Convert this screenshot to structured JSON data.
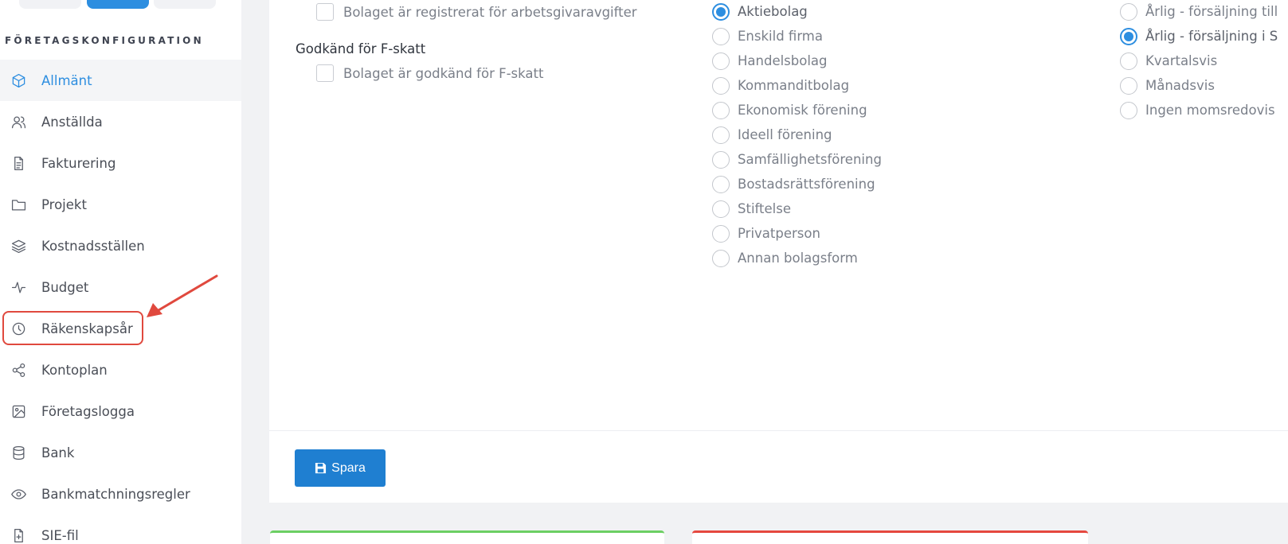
{
  "sidebar": {
    "section_title": "FÖRETAGSKONFIGURATION",
    "items": [
      {
        "label": "Allmänt",
        "icon": "cube-icon",
        "active": true
      },
      {
        "label": "Anställda",
        "icon": "users-icon"
      },
      {
        "label": "Fakturering",
        "icon": "document-icon"
      },
      {
        "label": "Projekt",
        "icon": "folder-icon"
      },
      {
        "label": "Kostnadsställen",
        "icon": "layers-icon"
      },
      {
        "label": "Budget",
        "icon": "activity-icon"
      },
      {
        "label": "Räkenskapsår",
        "icon": "clock-icon"
      },
      {
        "label": "Kontoplan",
        "icon": "share-icon"
      },
      {
        "label": "Företagslogga",
        "icon": "image-icon"
      },
      {
        "label": "Bank",
        "icon": "database-icon"
      },
      {
        "label": "Bankmatchningsregler",
        "icon": "eye-icon"
      },
      {
        "label": "SIE-fil",
        "icon": "file-plus-icon"
      }
    ]
  },
  "form": {
    "employer_fee_checkbox": "Bolaget är registrerat för arbetsgivaravgifter",
    "f_tax_heading": "Godkänd för F-skatt",
    "f_tax_checkbox": "Bolaget är godkänd för F-skatt",
    "company_types": [
      {
        "label": "Aktiebolag",
        "checked": true
      },
      {
        "label": "Enskild firma"
      },
      {
        "label": "Handelsbolag"
      },
      {
        "label": "Kommanditbolag"
      },
      {
        "label": "Ekonomisk förening"
      },
      {
        "label": "Ideell förening"
      },
      {
        "label": "Samfällighetsförening"
      },
      {
        "label": "Bostadsrättsförening"
      },
      {
        "label": "Stiftelse"
      },
      {
        "label": "Privatperson"
      },
      {
        "label": "Annan bolagsform"
      }
    ],
    "vat_periods": [
      {
        "label": "Årlig - försäljning till"
      },
      {
        "label": "Årlig - försäljning i S",
        "checked": true
      },
      {
        "label": "Kvartalsvis"
      },
      {
        "label": "Månadsvis"
      },
      {
        "label": "Ingen momsredovis"
      }
    ],
    "save_label": "Spara"
  },
  "colors": {
    "accent": "#2d8ee0",
    "annotation": "#e0493e"
  }
}
